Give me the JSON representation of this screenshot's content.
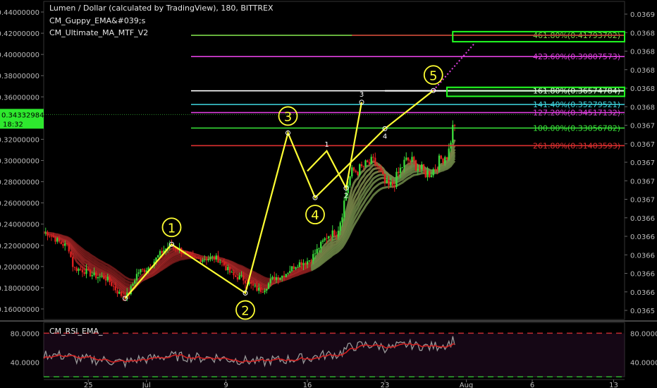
{
  "chart_data": {
    "type": "line",
    "title": "Lumen / Dollar (calculated by TradingView), 180, BITTREX",
    "indicators": [
      "CM_Guppy_EMA&#039;s",
      "CM_Ultimate_MA_MTF_V2"
    ],
    "x_axis": {
      "ticks": [
        "25",
        "Jul",
        "9",
        "16",
        "23",
        "Aug",
        "6",
        "13"
      ]
    },
    "y_axis_left": {
      "range": [
        0.15,
        0.45
      ],
      "ticks": [
        "0.44000000",
        "0.42000000",
        "0.40000000",
        "0.38000000",
        "0.36000000",
        "0.34000000",
        "0.32000000",
        "0.30000000",
        "0.28000000",
        "0.26000000",
        "0.24000000",
        "0.22000000",
        "0.20000000",
        "0.18000000",
        "0.16000000"
      ]
    },
    "y_axis_right_ticks": [
      "0.0369",
      "0.0368",
      "0.0368",
      "0.0368",
      "0.0368",
      "0.0368",
      "0.0367",
      "0.0367",
      "0.0367",
      "0.0367",
      "0.0367",
      "0.0366",
      "0.0366",
      "0.0366",
      "0.0366",
      "0.0366",
      "0.0365"
    ],
    "current_price": {
      "value": 0.34332984,
      "label": "0.34332984",
      "time_label": "18:32"
    },
    "fib_levels": [
      {
        "label": "461.80%(0.41793702)",
        "value": 0.418,
        "color": "#7cd84a"
      },
      {
        "label": "423.60%(0.39807573)",
        "value": 0.398,
        "color": "#e040e0"
      },
      {
        "label": "161.80%(0.36574784)",
        "value": 0.3657,
        "color": "#ffffff"
      },
      {
        "label": "141.40%(0.35279521)",
        "value": 0.3528,
        "color": "#3fd6e0"
      },
      {
        "label": "127.20%(0.34517132)",
        "value": 0.3452,
        "color": "#e040e0"
      },
      {
        "label": "100.00%(0.33056782)",
        "value": 0.3306,
        "color": "#39e639"
      },
      {
        "label": "261.80%(0.31403593)",
        "value": 0.314,
        "color": "#e03030"
      }
    ],
    "elliott_labels_major": [
      "1",
      "2",
      "3",
      "4",
      "5"
    ],
    "elliott_labels_minor": [
      "1",
      "2",
      "3",
      "4"
    ],
    "rsi": {
      "title": "CM_RSI_EMA_",
      "ticks": [
        "80.0000",
        "40.0000"
      ],
      "range": [
        20,
        95
      ],
      "levels": [
        80,
        20
      ]
    },
    "colors": {
      "background": "#000000",
      "candle_up": "#3ad63a",
      "candle_down": "#e02020",
      "wave": "#ffff33",
      "ribbon_red": "#b22a2a",
      "ribbon_green": "#5ab85a",
      "rsi_line": "#999999",
      "rsi_ema": "#d02020"
    }
  }
}
